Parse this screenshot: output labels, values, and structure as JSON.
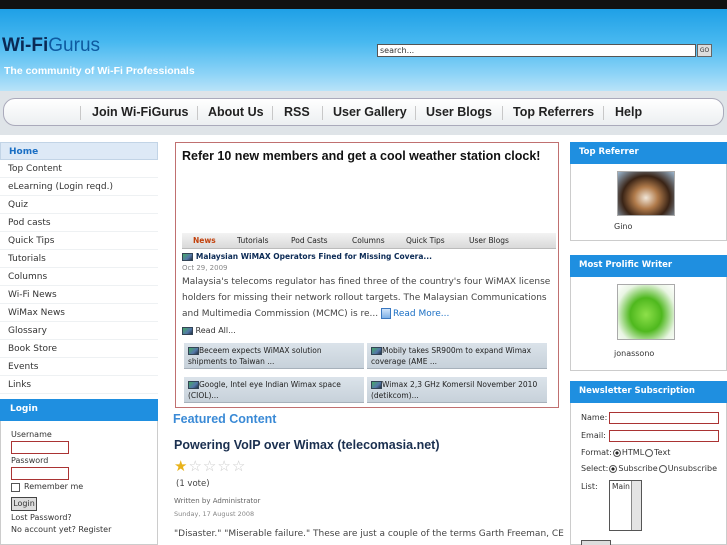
{
  "header": {
    "logo_wi": "Wi-Fi",
    "logo_gurus": "Gurus",
    "tagline": "The community of Wi-Fi Professionals",
    "search_value": "search...",
    "search_button": "GO"
  },
  "nav": [
    {
      "label": "Join Wi-FiGurus"
    },
    {
      "label": "About Us"
    },
    {
      "label": "RSS"
    },
    {
      "label": "User Gallery"
    },
    {
      "label": "User Blogs"
    },
    {
      "label": "Top Referrers"
    },
    {
      "label": "Help"
    }
  ],
  "sidebar": {
    "items": [
      {
        "label": "Home"
      },
      {
        "label": "Top Content"
      },
      {
        "label": "eLearning (Login reqd.)"
      },
      {
        "label": "Quiz"
      },
      {
        "label": "Pod casts"
      },
      {
        "label": "Quick Tips"
      },
      {
        "label": "Tutorials"
      },
      {
        "label": "Columns"
      },
      {
        "label": "Wi-Fi News"
      },
      {
        "label": "WiMax News"
      },
      {
        "label": "Glossary"
      },
      {
        "label": "Book Store"
      },
      {
        "label": "Events"
      },
      {
        "label": "Links"
      }
    ]
  },
  "login": {
    "title": "Login",
    "username_label": "Username",
    "password_label": "Password",
    "remember_label": "Remember me",
    "button": "Login",
    "lost_password": "Lost Password?",
    "register": "No account yet? Register"
  },
  "promo": {
    "title": "Refer 10 new members and get a cool weather station clock!",
    "tabs": [
      {
        "label": "News"
      },
      {
        "label": "Tutorials"
      },
      {
        "label": "Pod Casts"
      },
      {
        "label": "Columns"
      },
      {
        "label": "Quick Tips"
      },
      {
        "label": "User Blogs"
      }
    ],
    "news_title": "Malaysian WiMAX Operators Fined for Missing Covera...",
    "news_date": "Oct 29, 2009",
    "news_body": "Malaysia's telecoms regulator has fined three of the country's four WiMAX license holders for missing their network rollout targets. The Malaysian Communications and Multimedia Commission (MCMC) is re...",
    "read_more": "Read More...",
    "read_all": "Read All...",
    "minis": [
      {
        "text": "Beceem expects WiMAX solution shipments to Taiwan ..."
      },
      {
        "text": "Mobily takes SR900m to expand Wimax coverage (AME ..."
      },
      {
        "text": "Google, Intel eye Indian Wimax space (CIOL)..."
      },
      {
        "text": "Wimax 2,3 GHz Komersil November 2010 (detikcom)..."
      }
    ]
  },
  "featured": {
    "heading": "Featured Content",
    "title": "Powering VoIP over Wimax (telecomasia.net)",
    "rating": 1,
    "rating_max": 5,
    "votes": "(1 vote)",
    "written_by": "Written by",
    "author": "Administrator",
    "date": "Sunday, 17 August 2008",
    "text": "\"Disaster.\" \"Miserable failure.\" These are just a couple of the terms Garth Freeman, CEO"
  },
  "right": {
    "top_referrer_title": "Top Referrer",
    "top_referrer_name": "Gino",
    "prolific_title": "Most Prolific Writer",
    "prolific_name": "jonassono",
    "newsletter_title": "Newsletter Subscription",
    "name_label": "Name:",
    "email_label": "Email:",
    "format_label": "Format:",
    "format_html": "HTML",
    "format_text": "Text",
    "select_label": "Select:",
    "subscribe": "Subscribe",
    "unsubscribe": "Unsubscribe",
    "list_label": "List:",
    "list_value": "Main"
  }
}
